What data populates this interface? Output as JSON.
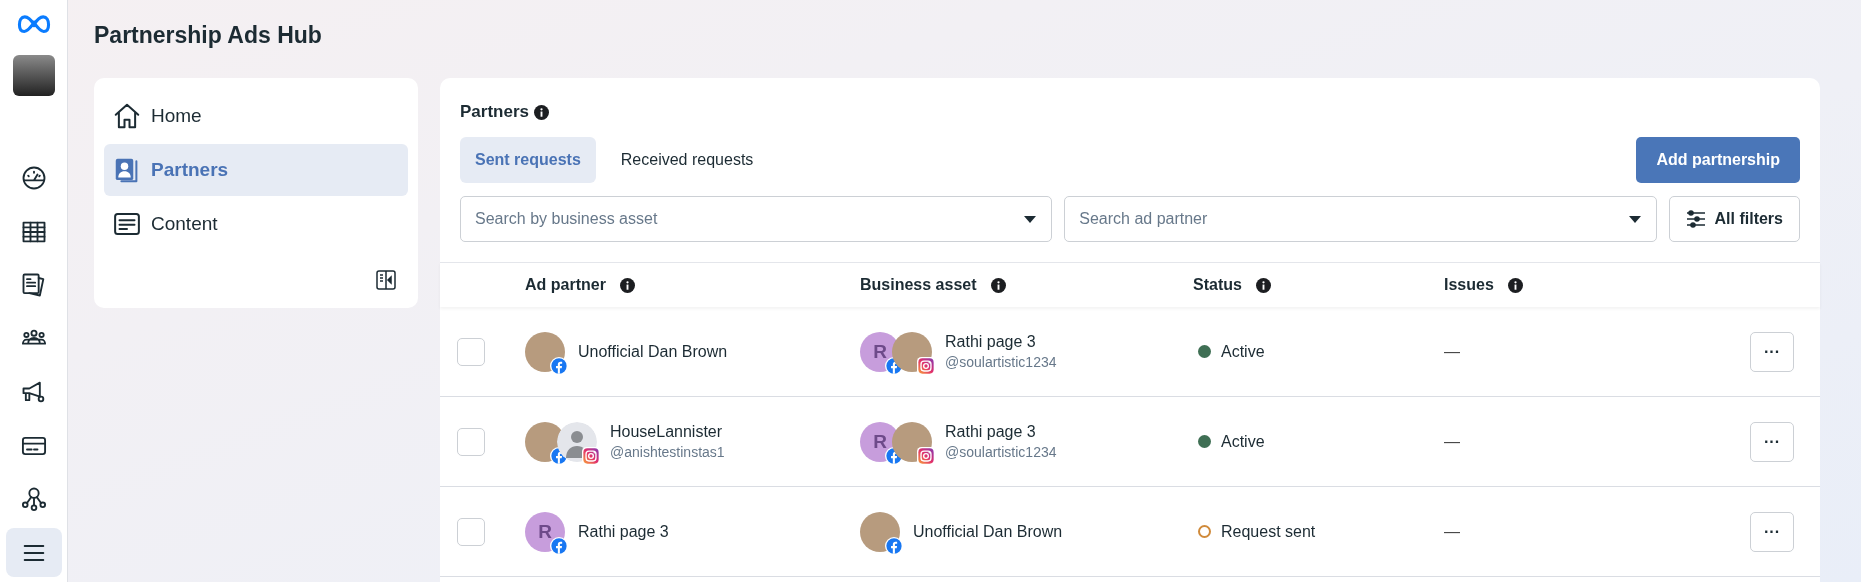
{
  "rail": {
    "items": [
      {
        "selected": false
      },
      {
        "selected": false
      },
      {
        "selected": false
      },
      {
        "selected": false
      },
      {
        "selected": false
      },
      {
        "selected": false
      },
      {
        "selected": false
      },
      {
        "selected": true
      }
    ]
  },
  "header": {
    "title": "Partnership Ads Hub"
  },
  "nav": {
    "items": [
      {
        "label": "Home",
        "selected": false
      },
      {
        "label": "Partners",
        "selected": true
      },
      {
        "label": "Content",
        "selected": false
      }
    ]
  },
  "partners": {
    "title": "Partners",
    "tabs": [
      {
        "label": "Sent requests",
        "selected": true
      },
      {
        "label": "Received requests",
        "selected": false
      }
    ],
    "add_button": "Add partnership",
    "filters": [
      {
        "placeholder": "Search by business asset"
      },
      {
        "placeholder": "Search ad partner"
      }
    ],
    "all_filters": "All filters",
    "columns": [
      "Ad partner",
      "Business asset",
      "Status",
      "Issues"
    ],
    "rows": [
      {
        "checked": false,
        "ad_partner": {
          "avatars": [
            {
              "kind": "photo",
              "badge": {
                "kind": "facebook"
              }
            }
          ],
          "name": "Unofficial Dan Brown"
        },
        "business_asset": {
          "avatars": [
            {
              "kind": "letter",
              "initial": "R",
              "badge": {
                "kind": "facebook"
              }
            },
            {
              "kind": "photo",
              "badge": {
                "kind": "instagram"
              }
            }
          ],
          "name": "Rathi page 3",
          "handle": "@soulartistic1234"
        },
        "status": {
          "label": "Active",
          "kind": "filled",
          "color": "#3f6f54"
        },
        "issues": "—",
        "more": "···"
      },
      {
        "checked": false,
        "ad_partner": {
          "avatars": [
            {
              "kind": "photo",
              "badge": {
                "kind": "facebook"
              }
            },
            {
              "kind": "silhouette",
              "badge": {
                "kind": "instagram"
              }
            }
          ],
          "name": "HouseLannister",
          "handle": "@anishtestinstas1"
        },
        "business_asset": {
          "avatars": [
            {
              "kind": "letter",
              "initial": "R",
              "badge": {
                "kind": "facebook"
              }
            },
            {
              "kind": "photo",
              "badge": {
                "kind": "instagram"
              }
            }
          ],
          "name": "Rathi page 3",
          "handle": "@soulartistic1234"
        },
        "status": {
          "label": "Active",
          "kind": "filled",
          "color": "#3f6f54"
        },
        "issues": "—",
        "more": "···"
      },
      {
        "checked": false,
        "ad_partner": {
          "avatars": [
            {
              "kind": "letter",
              "initial": "R",
              "badge": {
                "kind": "facebook"
              }
            }
          ],
          "name": "Rathi page 3"
        },
        "business_asset": {
          "avatars": [
            {
              "kind": "photo",
              "badge": {
                "kind": "facebook"
              }
            }
          ],
          "name": "Unofficial Dan Brown"
        },
        "status": {
          "label": "Request sent",
          "kind": "ring",
          "color": "#d08a3a"
        },
        "issues": "—",
        "more": "···"
      }
    ]
  }
}
